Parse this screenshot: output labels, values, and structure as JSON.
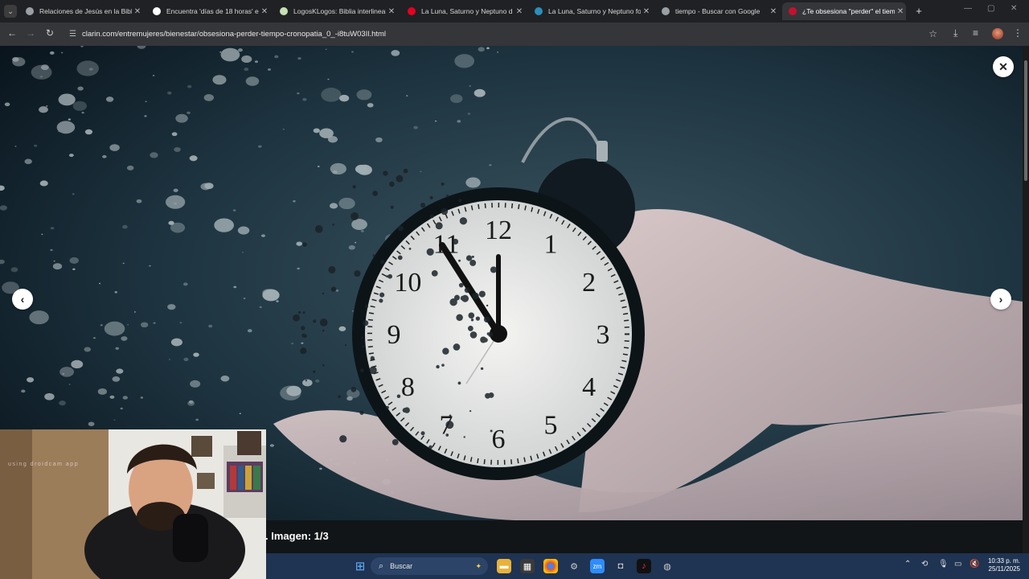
{
  "browser": {
    "tabs": [
      {
        "label": "Relaciones de Jesús en la Biblia",
        "color": "#9aa0a6"
      },
      {
        "label": "Encuentra 'días de 18 horas' en",
        "color": "#ffffff"
      },
      {
        "label": "LogosKLogos: Biblia interlineal",
        "color": "#c6e0b4"
      },
      {
        "label": "La Luna, Saturno y Neptuno d",
        "color": "#e60023"
      },
      {
        "label": "La Luna, Saturno y Neptuno for",
        "color": "#2a8fbd"
      },
      {
        "label": "tiempo - Buscar con Google",
        "color": "#9aa0a6"
      },
      {
        "label": "¿Te obsesiona \"perder\" el tiem",
        "color": "#c8102e"
      }
    ],
    "active_tab": 6,
    "new_tab_icon": "plus-icon",
    "url": "clarin.com/entremujeres/bienestar/obsesiona-perder-tiempo-cronopatia_0_-i8tuW03Il.html"
  },
  "gallery": {
    "caption": ". Imagen: 1/3",
    "close_icon": "close-icon",
    "prev_icon": "chevron-left-icon",
    "next_icon": "chevron-right-icon",
    "clock_numbers": [
      "12",
      "1",
      "2",
      "3",
      "4",
      "5",
      "6",
      "7",
      "8",
      "9",
      "10",
      "11"
    ]
  },
  "webcam": {
    "watermark": "using droidcam app"
  },
  "taskbar": {
    "search_placeholder": "Buscar"
  },
  "clock": {
    "time": "10:33 p. m.",
    "date": "25/11/2025"
  }
}
